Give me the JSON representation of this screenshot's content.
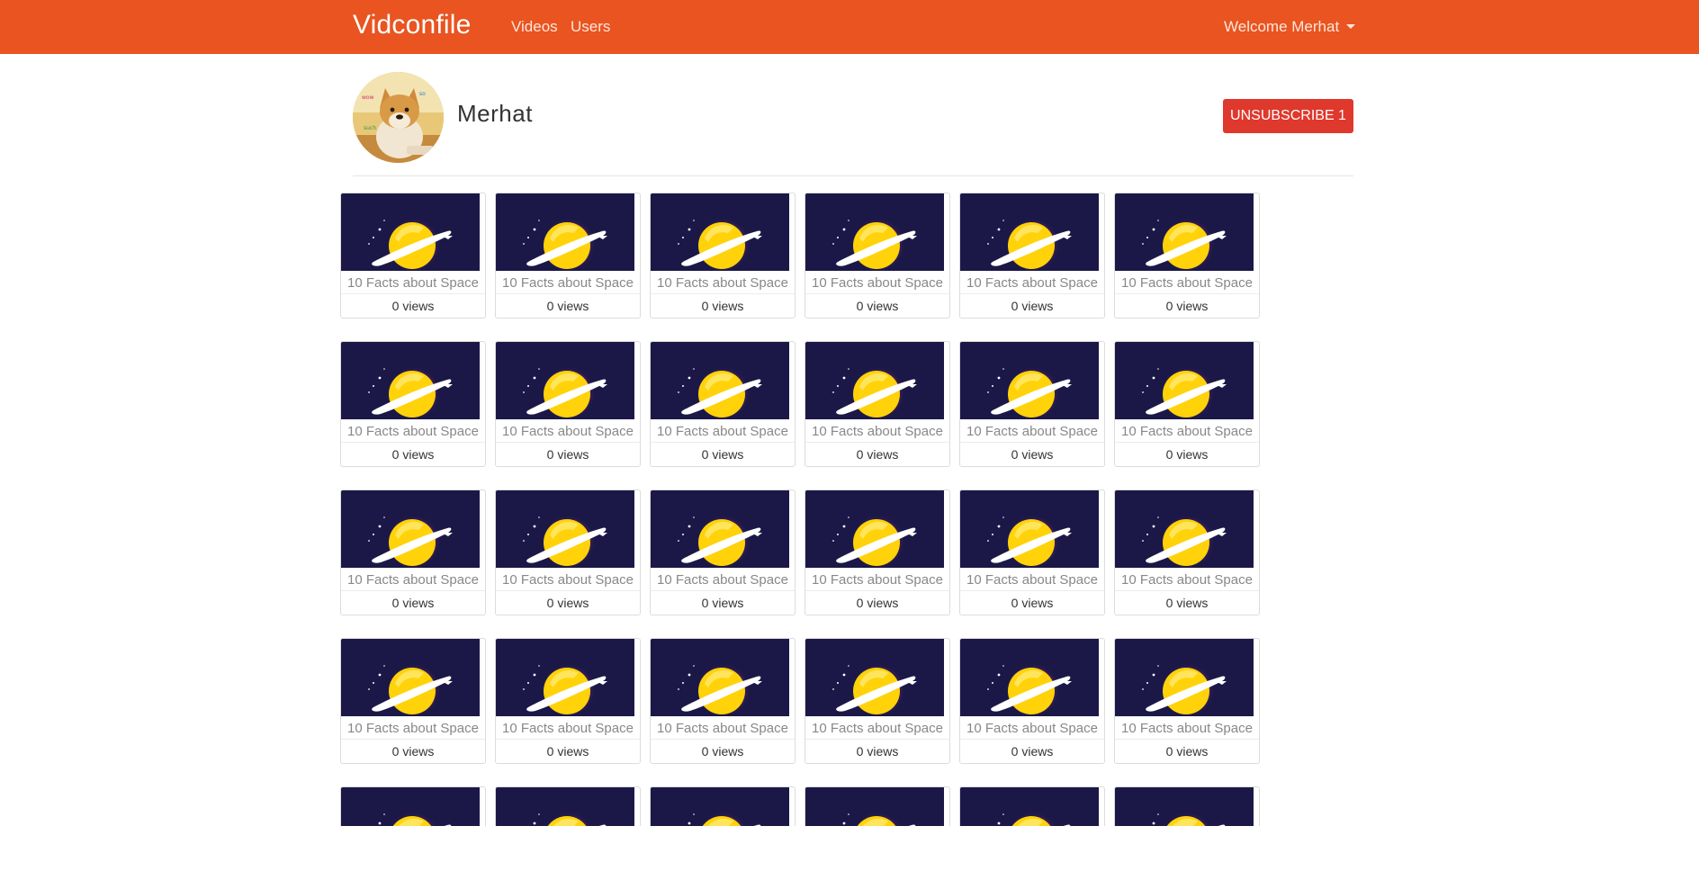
{
  "app": {
    "brand": "Vidconfile"
  },
  "nav": {
    "links": [
      "Videos",
      "Users"
    ],
    "welcome": "Welcome Merhat"
  },
  "profile": {
    "name": "Merhat",
    "button_label": "UNSUBSCRIBE 1"
  },
  "colors": {
    "navbar": "#E95420",
    "button": "#DF382C",
    "thumb_bg": "#1b1848",
    "planet": "#FFD20A"
  },
  "video_card": {
    "title": "10 Facts about Space",
    "views": "0 views"
  },
  "video_count": 30,
  "icons": {
    "nav_dropdown": "caret-down-icon",
    "avatar": "doge-avatar-image",
    "thumbnail": "planet-thumbnail-image"
  }
}
